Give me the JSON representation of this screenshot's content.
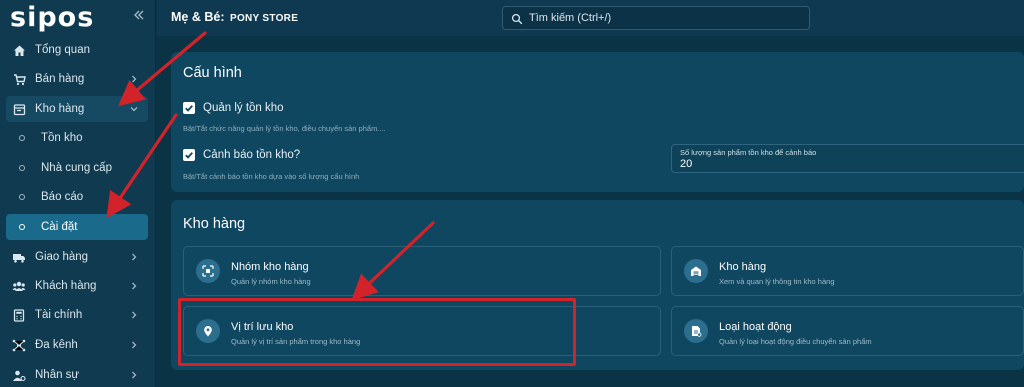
{
  "sidebar": {
    "logo": "sipos",
    "items": [
      {
        "label": "Tổng quan",
        "icon": "home-icon"
      },
      {
        "label": "Bán hàng",
        "icon": "cart-icon"
      },
      {
        "label": "Kho hàng",
        "icon": "warehouse-icon"
      },
      {
        "label": "Giao hàng",
        "icon": "truck-icon"
      },
      {
        "label": "Khách hàng",
        "icon": "users-icon"
      },
      {
        "label": "Tài chính",
        "icon": "calculator-icon"
      },
      {
        "label": "Đa kênh",
        "icon": "channels-icon"
      },
      {
        "label": "Nhân sự",
        "icon": "staff-icon"
      }
    ],
    "sub_items": [
      {
        "label": "Tồn kho"
      },
      {
        "label": "Nhà cung cấp"
      },
      {
        "label": "Báo cáo"
      },
      {
        "label": "Cài đặt"
      }
    ]
  },
  "header": {
    "title_prefix": "Mẹ & Bé:",
    "store_name": "PONY STORE",
    "search_placeholder": "Tìm kiếm (Ctrl+/)"
  },
  "config": {
    "title": "Cấu hình",
    "inventory_toggle": {
      "label": "Quản lý tồn kho",
      "checked": true,
      "hint": "Bật/Tắt chức năng quản lý tồn kho, điều chuyển sản phẩm...."
    },
    "stock_alert_toggle": {
      "label": "Cảnh báo tồn kho?",
      "checked": true,
      "hint": "Bật/Tắt cảnh báo tồn kho dựa vào số lượng cấu hình"
    },
    "threshold_field": {
      "label": "Số lượng sản phẩm tồn kho để cảnh báo",
      "value": "20"
    }
  },
  "warehouse": {
    "title": "Kho hàng",
    "tiles": [
      {
        "title": "Nhóm kho hàng",
        "subtitle": "Quản lý nhóm kho hàng"
      },
      {
        "title": "Kho hàng",
        "subtitle": "Xem và quan lý thông tin kho hàng"
      },
      {
        "title": "Vị trí lưu kho",
        "subtitle": "Quản lý vị trí sản phẩm trong kho hàng"
      },
      {
        "title": "Loại hoạt động",
        "subtitle": "Quản lý loại hoạt động điều chuyển sản phẩm"
      }
    ]
  },
  "colors": {
    "accent": "#1a6a8c",
    "annotation": "#d2232a",
    "background": "#0b3346"
  }
}
